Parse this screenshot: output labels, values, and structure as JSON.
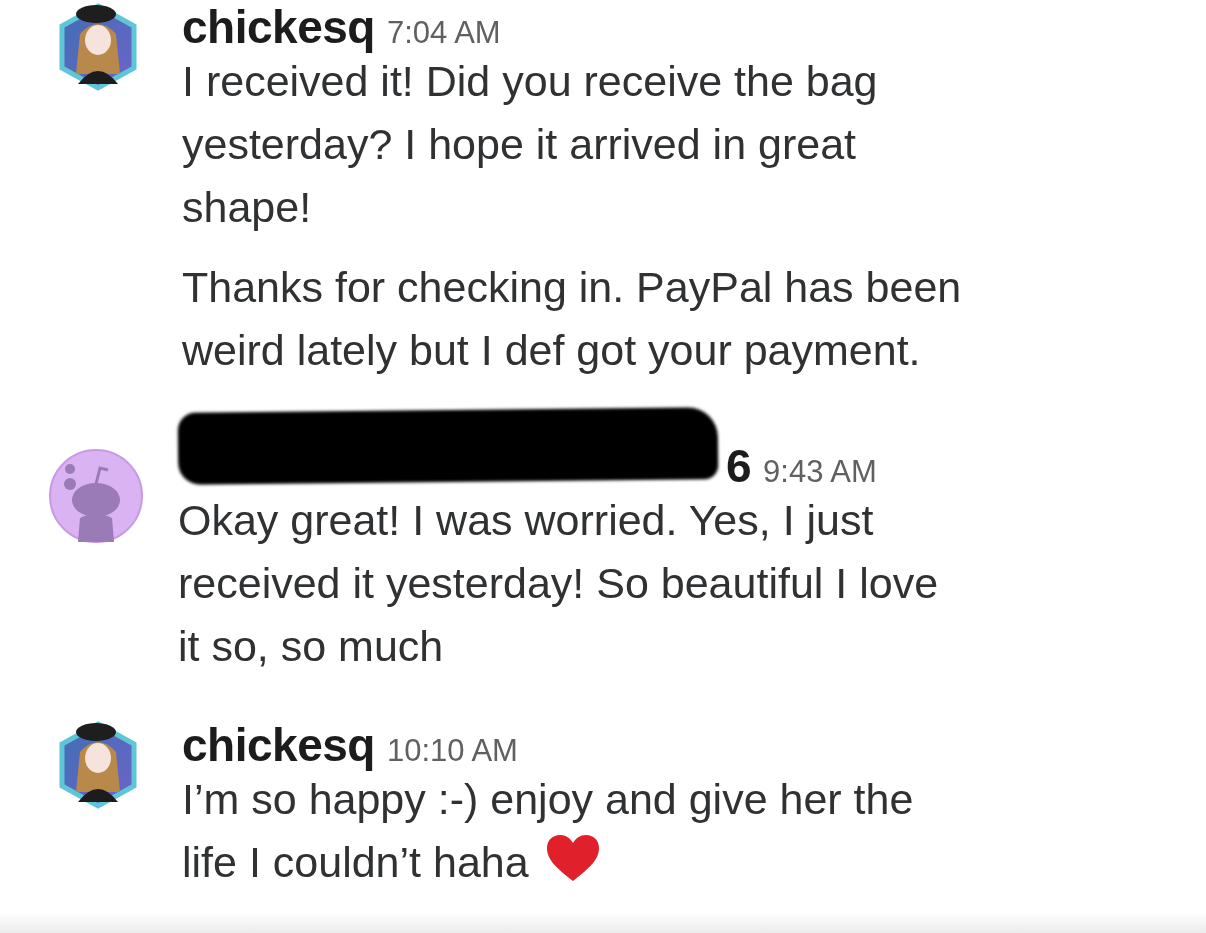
{
  "messages": [
    {
      "avatar": {
        "kind": "hexagon"
      },
      "author": "chickesq",
      "redacted": false,
      "time": "7:04 AM",
      "paragraphs": [
        {
          "lines": [
            "I received it! Did you receive the bag",
            "yesterday? I hope it arrived in great",
            "shape!"
          ]
        },
        {
          "lines": [
            "Thanks for checking in. PayPal has been",
            "weird lately but I def got your payment."
          ]
        }
      ]
    },
    {
      "avatar": {
        "kind": "circle"
      },
      "author": "6",
      "redacted": true,
      "time": "9:43 AM",
      "paragraphs": [
        {
          "lines": [
            "Okay great! I was worried. Yes, I just",
            "received it yesterday! So beautiful I love",
            "it so, so much"
          ]
        }
      ]
    },
    {
      "avatar": {
        "kind": "hexagon"
      },
      "author": "chickesq",
      "redacted": false,
      "time": "10:10 AM",
      "paragraphs": [
        {
          "lines": [
            "I’m so happy :-) enjoy and give her the",
            "life I couldn’t haha"
          ],
          "trailing_icon": {
            "kind": "heart"
          }
        }
      ]
    }
  ]
}
